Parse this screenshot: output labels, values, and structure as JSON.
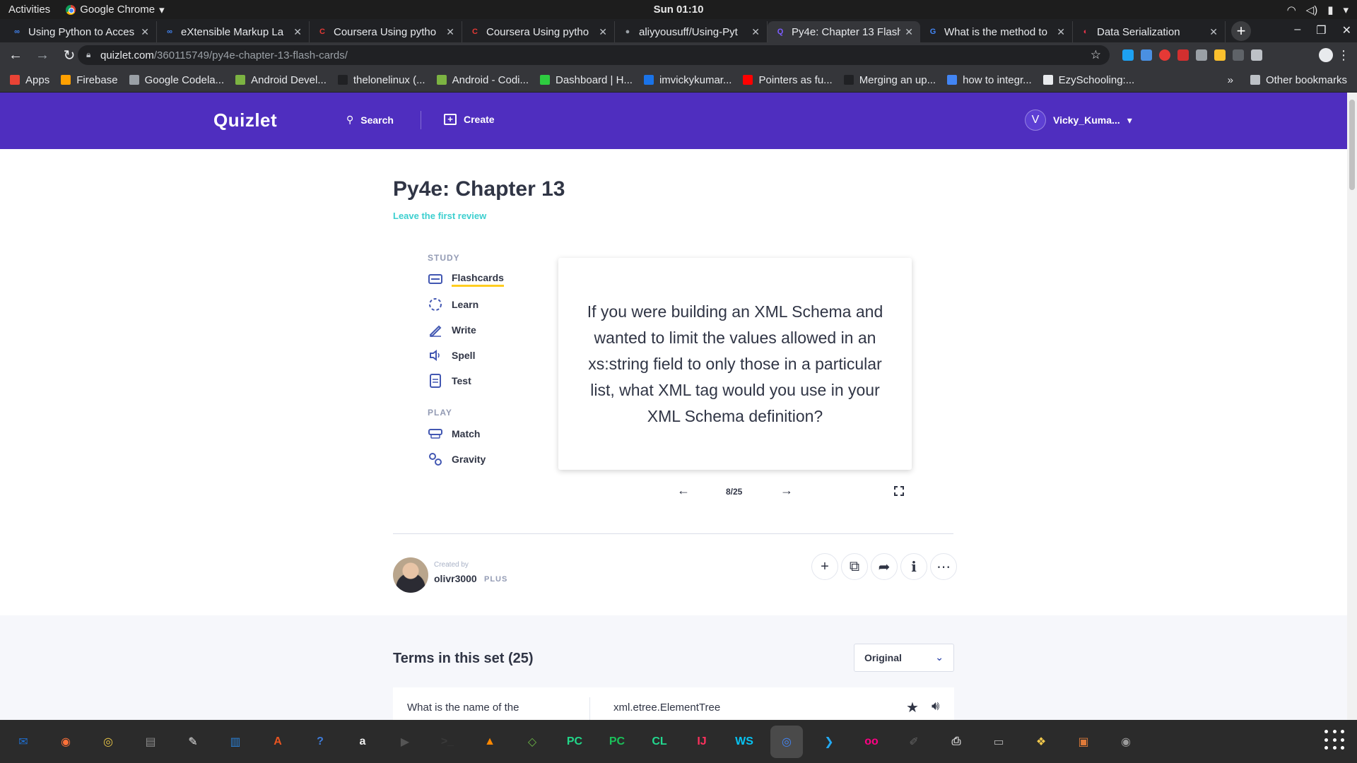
{
  "system": {
    "activities": "Activities",
    "app_name": "Google Chrome",
    "clock": "Sun 01:10"
  },
  "tabs": [
    {
      "title": "Using Python to Acces",
      "favicon_color": "#4285f4",
      "favicon": "∞"
    },
    {
      "title": "eXtensible Markup La",
      "favicon_color": "#4285f4",
      "favicon": "∞"
    },
    {
      "title": "Coursera Using pytho",
      "favicon_color": "#e53935",
      "favicon": "C"
    },
    {
      "title": "Coursera Using pytho",
      "favicon_color": "#e53935",
      "favicon": "C"
    },
    {
      "title": "aliyyousuff/Using-Pyt",
      "favicon_color": "#9aa0a6",
      "favicon": "●"
    },
    {
      "title": "Py4e: Chapter 13 Flash",
      "favicon_color": "#7c5cff",
      "favicon": "Q",
      "active": true
    },
    {
      "title": "What is the method to",
      "favicon_color": "#4285f4",
      "favicon": "G"
    },
    {
      "title": "Data Serialization",
      "favicon_color": "#e8334a",
      "favicon": "◐"
    }
  ],
  "address": {
    "host": "quizlet.com",
    "path": "/360115749/py4e-chapter-13-flash-cards/"
  },
  "bookmarks": [
    {
      "label": "Apps",
      "color": "#ea4335"
    },
    {
      "label": "Firebase",
      "color": "#ffa000"
    },
    {
      "label": "Google Codela...",
      "color": "#9aa0a6"
    },
    {
      "label": "Android Devel...",
      "color": "#7cb342"
    },
    {
      "label": "thelonelinux (...",
      "color": "#202124"
    },
    {
      "label": "Android - Codi...",
      "color": "#7cb342"
    },
    {
      "label": "Dashboard | H...",
      "color": "#2ecc40"
    },
    {
      "label": "imvickykumar...",
      "color": "#1a73e8"
    },
    {
      "label": "Pointers as fu...",
      "color": "#ff0000"
    },
    {
      "label": "Merging an up...",
      "color": "#202124"
    },
    {
      "label": "how to integr...",
      "color": "#4285f4"
    },
    {
      "label": "EzySchooling:...",
      "color": "#e8eaed"
    }
  ],
  "bookmarks_more": "»",
  "other_bookmarks": "Other bookmarks",
  "quizlet": {
    "logo": "Quizlet",
    "search": "Search",
    "create": "Create",
    "user_initial": "V",
    "user_name": "Vicky_Kuma...",
    "brand_color": "#4f2ebf"
  },
  "set": {
    "title": "Py4e: Chapter 13",
    "review_link": "Leave the first review"
  },
  "study": {
    "study_label": "STUDY",
    "play_label": "PLAY",
    "modes": [
      {
        "label": "Flashcards",
        "icon": "flashcards-icon",
        "active": true
      },
      {
        "label": "Learn",
        "icon": "learn-icon"
      },
      {
        "label": "Write",
        "icon": "write-icon"
      },
      {
        "label": "Spell",
        "icon": "spell-icon"
      },
      {
        "label": "Test",
        "icon": "test-icon"
      }
    ],
    "play_modes": [
      {
        "label": "Match",
        "icon": "match-icon"
      },
      {
        "label": "Gravity",
        "icon": "gravity-icon"
      }
    ]
  },
  "flashcard": {
    "text": "If you were building an XML Schema and wanted to limit the values allowed in an xs:string field to only those in a particular list, what XML tag would you use in your XML Schema definition?",
    "counter": "8/25"
  },
  "creator": {
    "created_by": "Created by",
    "name": "olivr3000",
    "badge": "PLUS"
  },
  "terms": {
    "title": "Terms in this set (25)",
    "sort": "Original",
    "first_term": "What is the name of the",
    "first_definition": "xml.etree.ElementTree"
  },
  "dock": [
    {
      "name": "thunderbird-icon",
      "color": "#1f6fd0",
      "glyph": "✉"
    },
    {
      "name": "firefox-icon",
      "color": "#ff7139",
      "glyph": "◉"
    },
    {
      "name": "rhythmbox-icon",
      "color": "#e8c547",
      "glyph": "◎"
    },
    {
      "name": "files-icon",
      "color": "#8a8a8a",
      "glyph": "▤"
    },
    {
      "name": "text-editor-icon",
      "color": "#e8e8e8",
      "glyph": "✎"
    },
    {
      "name": "writer-icon",
      "color": "#2a7fd4",
      "glyph": "▥"
    },
    {
      "name": "software-center-icon",
      "color": "#e95420",
      "glyph": "A"
    },
    {
      "name": "help-icon",
      "color": "#3e7bd8",
      "glyph": "?"
    },
    {
      "name": "amazon-icon",
      "color": "#f0f0f0",
      "glyph": "a"
    },
    {
      "name": "video-editor-icon",
      "color": "#555555",
      "glyph": "▶"
    },
    {
      "name": "terminal-icon",
      "color": "#3a3a3a",
      "glyph": ">_"
    },
    {
      "name": "vlc-icon",
      "color": "#ff8800",
      "glyph": "▲"
    },
    {
      "name": "android-studio-icon",
      "color": "#6ab344",
      "glyph": "◇"
    },
    {
      "name": "pycharm-icon",
      "color": "#21d789",
      "glyph": "PC"
    },
    {
      "name": "pycharm-pro-icon",
      "color": "#1bc15a",
      "glyph": "PC"
    },
    {
      "name": "clion-icon",
      "color": "#22d88f",
      "glyph": "CL"
    },
    {
      "name": "intellij-icon",
      "color": "#fe315d",
      "glyph": "IJ"
    },
    {
      "name": "webstorm-icon",
      "color": "#07c3f2",
      "glyph": "WS"
    },
    {
      "name": "chrome-icon",
      "color": "#4285f4",
      "glyph": "◎",
      "active": true
    },
    {
      "name": "vscode-icon",
      "color": "#23a9f2",
      "glyph": "❯"
    },
    {
      "name": "flickr-icon",
      "color": "#ff0084",
      "glyph": "oo"
    },
    {
      "name": "color-picker-icon",
      "color": "#666666",
      "glyph": "✐"
    },
    {
      "name": "printer-icon",
      "color": "#d0d0d0",
      "glyph": "⎙"
    },
    {
      "name": "scanner-icon",
      "color": "#b0b0b0",
      "glyph": "▭"
    },
    {
      "name": "image-viewer-icon",
      "color": "#f2c94c",
      "glyph": "❖"
    },
    {
      "name": "archive-icon",
      "color": "#e07b39",
      "glyph": "▣"
    },
    {
      "name": "webcam-icon",
      "color": "#9b9b9b",
      "glyph": "◉"
    }
  ]
}
